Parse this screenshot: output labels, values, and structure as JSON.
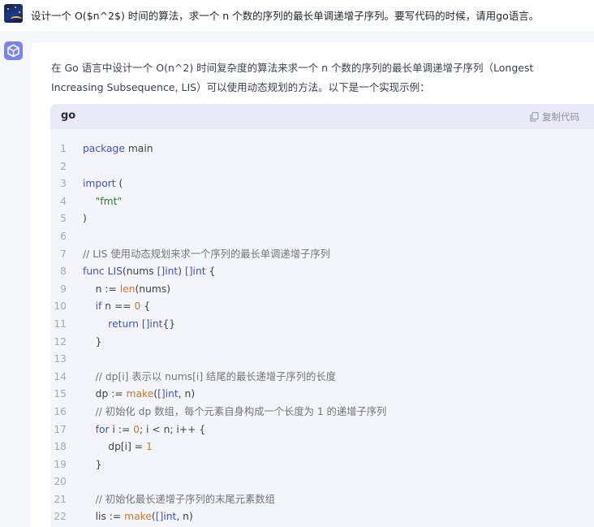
{
  "user_message": "设计一个 O($n^2$) 时间的算法，求一个 n 个数的序列的最长单调递增子序列。要写代码的时候，请用go语言。",
  "answer_intro": "在 Go 语言中设计一个 O(n^2) 时间复杂度的算法来求一个 n 个数的序列的最长单调递增子序列（Longest Increasing Subsequence, LIS）可以使用动态规划的方法。以下是一个实现示例：",
  "code_block": {
    "language": "go",
    "copy_label": "复制代码",
    "copy_icon": "copy-icon",
    "lines": [
      {
        "n": "1",
        "segs": [
          [
            "kw",
            "package"
          ],
          [
            "",
            " main"
          ]
        ]
      },
      {
        "n": "2",
        "segs": []
      },
      {
        "n": "3",
        "segs": [
          [
            "kw",
            "import"
          ],
          [
            "",
            " ("
          ]
        ]
      },
      {
        "n": "4",
        "segs": [
          [
            "",
            "    "
          ],
          [
            "st",
            "\"fmt\""
          ]
        ]
      },
      {
        "n": "5",
        "segs": [
          [
            "",
            ")"
          ]
        ]
      },
      {
        "n": "6",
        "segs": []
      },
      {
        "n": "7",
        "segs": [
          [
            "cm",
            "// LIS 使用动态规划来求一个序列的最长单调递增子序列"
          ]
        ]
      },
      {
        "n": "8",
        "segs": [
          [
            "kw",
            "func"
          ],
          [
            "",
            " "
          ],
          [
            "fn",
            "LIS"
          ],
          [
            "",
            "(nums "
          ],
          [
            "ty",
            "[]int"
          ],
          [
            "",
            ") "
          ],
          [
            "ty",
            "[]int"
          ],
          [
            "",
            " {"
          ]
        ]
      },
      {
        "n": "9",
        "segs": [
          [
            "",
            "    n := "
          ],
          [
            "bi",
            "len"
          ],
          [
            "",
            "(nums)"
          ]
        ]
      },
      {
        "n": "10",
        "segs": [
          [
            "",
            "    "
          ],
          [
            "kw",
            "if"
          ],
          [
            "",
            " n == "
          ],
          [
            "nm",
            "0"
          ],
          [
            "",
            " {"
          ]
        ]
      },
      {
        "n": "11",
        "segs": [
          [
            "",
            "        "
          ],
          [
            "kw",
            "return"
          ],
          [
            "",
            " "
          ],
          [
            "ty",
            "[]int"
          ],
          [
            "",
            "{}"
          ]
        ]
      },
      {
        "n": "12",
        "segs": [
          [
            "",
            "    }"
          ]
        ]
      },
      {
        "n": "13",
        "segs": []
      },
      {
        "n": "14",
        "segs": [
          [
            "",
            "    "
          ],
          [
            "cm",
            "// dp[i] 表示以 nums[i] 结尾的最长递增子序列的长度"
          ]
        ]
      },
      {
        "n": "15",
        "segs": [
          [
            "",
            "    dp := "
          ],
          [
            "bi",
            "make"
          ],
          [
            "",
            "("
          ],
          [
            "ty",
            "[]int"
          ],
          [
            "",
            ", n)"
          ]
        ]
      },
      {
        "n": "16",
        "segs": [
          [
            "",
            "    "
          ],
          [
            "cm",
            "// 初始化 dp 数组，每个元素自身构成一个长度为 1 的递增子序列"
          ]
        ]
      },
      {
        "n": "17",
        "segs": [
          [
            "",
            "    "
          ],
          [
            "kw",
            "for"
          ],
          [
            "",
            " i := "
          ],
          [
            "nm",
            "0"
          ],
          [
            "",
            "; i < n; i++ {"
          ]
        ]
      },
      {
        "n": "18",
        "segs": [
          [
            "",
            "        dp[i] = "
          ],
          [
            "nm",
            "1"
          ]
        ]
      },
      {
        "n": "19",
        "segs": [
          [
            "",
            "    }"
          ]
        ]
      },
      {
        "n": "20",
        "segs": []
      },
      {
        "n": "21",
        "segs": [
          [
            "",
            "    "
          ],
          [
            "cm",
            "// 初始化最长递增子序列的末尾元素数组"
          ]
        ]
      },
      {
        "n": "22",
        "segs": [
          [
            "",
            "    lis := "
          ],
          [
            "bi",
            "make"
          ],
          [
            "",
            "("
          ],
          [
            "ty",
            "[]int"
          ],
          [
            "",
            ", n)"
          ]
        ]
      }
    ]
  },
  "colors": {
    "keyword": "#3f51c2",
    "string": "#1e8722",
    "number": "#c2772a",
    "comment": "#6f747d",
    "bot_avatar": "#7a83f0"
  }
}
